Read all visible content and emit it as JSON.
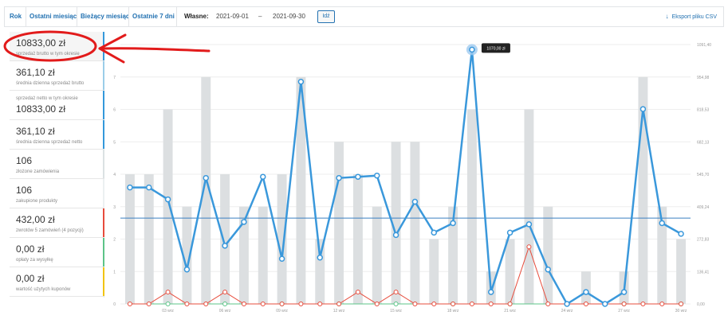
{
  "toolbar": {
    "tabs": [
      "Rok",
      "Ostatni miesiąc",
      "Bieżący miesiąc",
      "Ostatnie 7 dni"
    ],
    "custom_label": "Własne:",
    "date_from": "2021-09-01",
    "date_separator": "–",
    "date_to": "2021-09-30",
    "go_label": "Idź",
    "export_label": "Eksport pliku CSV",
    "export_icon": "download-icon"
  },
  "legend": {
    "items": [
      {
        "value": "10833,00 zł",
        "label": "sprzedaż brutto w tym okresie",
        "color": "#3498db"
      },
      {
        "value": "361,10 zł",
        "label": "średnia dzienna sprzedaż brutto",
        "color": "#9bcde9"
      },
      {
        "value": "10833,00 zł",
        "label": "sprzedaż netto w tym okresie",
        "color": "#3498db"
      },
      {
        "value": "361,10 zł",
        "label": "średnia dzienna sprzedaż netto",
        "color": "#3498db"
      },
      {
        "value": "106",
        "label": "złożone zamówienia",
        "color": "#dbe1e3"
      },
      {
        "value": "106",
        "label": "zakupione produkty",
        "color": "#ecf0f1"
      },
      {
        "value": "432,00 zł",
        "label": "zwrotów 5 zamówień (4 pozycji)",
        "color": "#e74c3c"
      },
      {
        "value": "0,00 zł",
        "label": "opłaty za wysyłkę",
        "color": "#5cc488"
      },
      {
        "value": "0,00 zł",
        "label": "wartość użytych kuponów",
        "color": "#f1c40f"
      }
    ]
  },
  "colors": {
    "accent": "#2271b1",
    "sales_line": "#3a98db",
    "average_line": "#3a7fc1",
    "bars": "#dcdfe1",
    "refunds": "#e74c3c",
    "shipping": "#5cc488",
    "annotation": "#e21b1b"
  },
  "chart_data": {
    "type": "bar",
    "x": [
      "01",
      "02",
      "03",
      "04",
      "05",
      "06",
      "07",
      "08",
      "09",
      "10",
      "11",
      "12",
      "13",
      "14",
      "15",
      "16",
      "17",
      "18",
      "19",
      "20",
      "21",
      "22",
      "23",
      "24",
      "25",
      "26",
      "27",
      "28",
      "29",
      "30"
    ],
    "x_tick_labels": [
      "03 wrz",
      "06 wrz",
      "09 wrz",
      "12 wrz",
      "15 wrz",
      "18 wrz",
      "21 wrz",
      "24 wrz",
      "27 wrz",
      "30 wrz"
    ],
    "left_ticks": [
      "0",
      "1",
      "2",
      "3",
      "4",
      "5",
      "6",
      "7"
    ],
    "right_ticks": [
      "0,00",
      "136,41",
      "272,83",
      "409,24",
      "545,70",
      "682,13",
      "818,53",
      "954,98",
      "1091,40"
    ],
    "ylim_left": [
      0,
      8
    ],
    "ylim_right": [
      0,
      1091.4
    ],
    "grid": true,
    "tooltip": {
      "day": "19",
      "text": "1070,00 zł"
    },
    "series": [
      {
        "name": "złożone zamówienia",
        "type": "bar",
        "axis": "left",
        "values": [
          4,
          4,
          6,
          3,
          7,
          4,
          3,
          3,
          4,
          7,
          2,
          5,
          4,
          3,
          5,
          5,
          2,
          3,
          6,
          1,
          2,
          6,
          3,
          0,
          1,
          0,
          1,
          7,
          3,
          2
        ]
      },
      {
        "name": "sprzedaż brutto w tym okresie",
        "type": "line",
        "axis": "right",
        "values": [
          490,
          490,
          440,
          145,
          530,
          245,
          345,
          535,
          190,
          935,
          195,
          530,
          535,
          540,
          290,
          430,
          300,
          340,
          1070,
          50,
          300,
          335,
          145,
          0,
          50,
          0,
          50,
          820,
          340,
          295
        ]
      },
      {
        "name": "średnia dzienna sprzedaż brutto",
        "type": "line",
        "axis": "right",
        "values": [
          361.1
        ]
      },
      {
        "name": "zwrotów 5 zamówień (4 pozycji)",
        "type": "line",
        "axis": "right",
        "values": [
          0,
          0,
          50,
          0,
          0,
          50,
          0,
          0,
          0,
          0,
          0,
          0,
          50,
          0,
          50,
          0,
          0,
          0,
          0,
          0,
          0,
          240,
          0,
          0,
          0,
          0,
          0,
          0,
          0,
          0
        ]
      },
      {
        "name": "opłaty za wysyłkę",
        "type": "line",
        "axis": "right",
        "values": [
          0,
          0,
          0,
          0,
          0,
          0,
          0,
          0,
          0,
          0,
          0,
          0,
          0,
          0,
          0,
          0,
          0,
          0,
          0,
          0,
          0,
          0,
          0,
          0,
          0,
          0,
          0,
          0,
          0,
          0
        ]
      }
    ]
  }
}
